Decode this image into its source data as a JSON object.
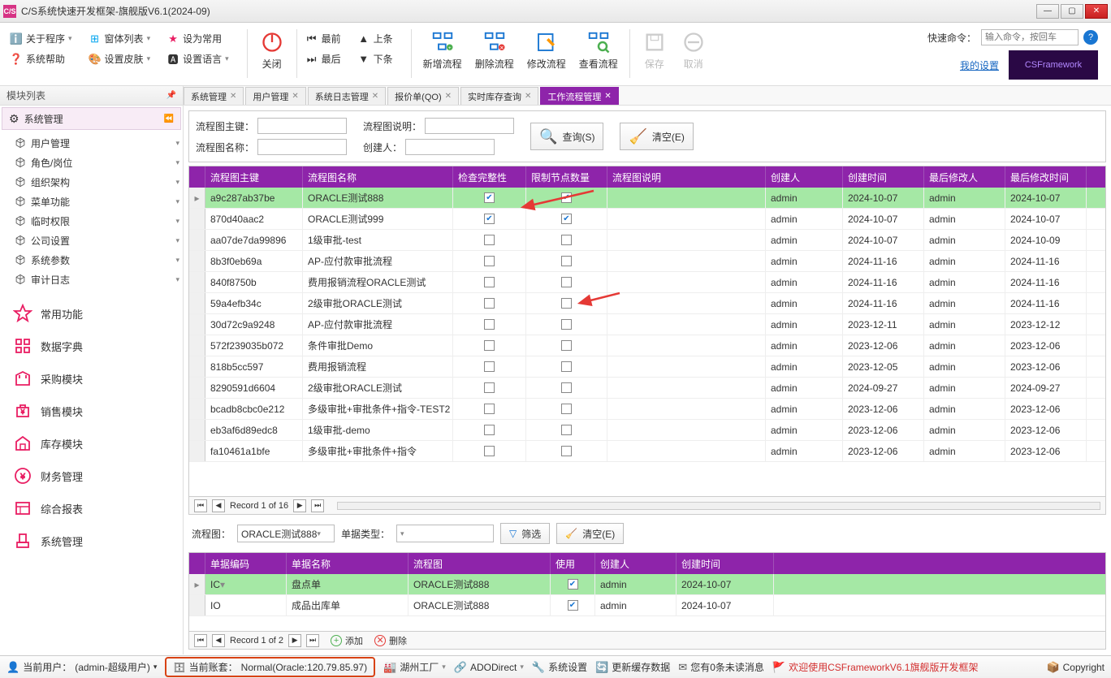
{
  "window": {
    "title": "C/S系统快速开发框架-旗舰版V6.1(2024-09)"
  },
  "menubar": {
    "about": "关于程序",
    "winlist": "窗体列表",
    "setcommon": "设为常用",
    "syshelp": "系统帮助",
    "setskin": "设置皮肤",
    "setlang": "设置语言"
  },
  "toolbar": {
    "close": "关闭",
    "first": "最前",
    "last": "最后",
    "prev": "上条",
    "next": "下条",
    "addflow": "新增流程",
    "delflow": "删除流程",
    "editflow": "修改流程",
    "viewflow": "查看流程",
    "save": "保存",
    "cancel": "取消",
    "quickcmd_label": "快速命令：",
    "quickcmd_placeholder": "输入命令，按回车",
    "mysettings": "我的设置",
    "brand": "CSFramework"
  },
  "sidebar": {
    "title": "模块列表",
    "active_cat": "系统管理",
    "tree": [
      {
        "label": "用户管理"
      },
      {
        "label": "角色/岗位"
      },
      {
        "label": "组织架构"
      },
      {
        "label": "菜单功能"
      },
      {
        "label": "临时权限"
      },
      {
        "label": "公司设置"
      },
      {
        "label": "系统参数"
      },
      {
        "label": "审计日志"
      }
    ],
    "quick": [
      {
        "label": "常用功能"
      },
      {
        "label": "数据字典"
      },
      {
        "label": "采购模块"
      },
      {
        "label": "销售模块"
      },
      {
        "label": "库存模块"
      },
      {
        "label": "财务管理"
      },
      {
        "label": "综合报表"
      },
      {
        "label": "系统管理"
      }
    ]
  },
  "tabs": [
    {
      "label": "系统管理"
    },
    {
      "label": "用户管理"
    },
    {
      "label": "系统日志管理"
    },
    {
      "label": "报价单(QO)"
    },
    {
      "label": "实时库存查询"
    },
    {
      "label": "工作流程管理",
      "active": true
    }
  ],
  "search": {
    "f1": "流程图主键：",
    "f2": "流程图说明：",
    "f3": "流程图名称：",
    "f4": "创建人：",
    "btn_query": "查询(S)",
    "btn_clear": "清空(E)"
  },
  "grid1": {
    "cols": [
      "流程图主键",
      "流程图名称",
      "检查完整性",
      "限制节点数量",
      "流程图说明",
      "创建人",
      "创建时间",
      "最后修改人",
      "最后修改时间"
    ],
    "rows": [
      {
        "id": "a9c287ab37be",
        "name": "ORACLE测试888",
        "chk": true,
        "lim": true,
        "desc": "",
        "creator": "admin",
        "ctime": "2024-10-07",
        "mod": "admin",
        "mtime": "2024-10-07",
        "hl": true,
        "sel": true
      },
      {
        "id": "870d40aac2",
        "name": "ORACLE测试999",
        "chk": true,
        "lim": true,
        "desc": "",
        "creator": "admin",
        "ctime": "2024-10-07",
        "mod": "admin",
        "mtime": "2024-10-07"
      },
      {
        "id": "aa07de7da99896",
        "name": "1级审批-test",
        "chk": false,
        "lim": false,
        "desc": "",
        "creator": "admin",
        "ctime": "2024-10-07",
        "mod": "admin",
        "mtime": "2024-10-09"
      },
      {
        "id": "8b3f0eb69a",
        "name": "AP-应付款审批流程",
        "chk": false,
        "lim": false,
        "desc": "",
        "creator": "admin",
        "ctime": "2024-11-16",
        "mod": "admin",
        "mtime": "2024-11-16"
      },
      {
        "id": "840f8750b",
        "name": "费用报销流程ORACLE测试",
        "chk": false,
        "lim": false,
        "desc": "",
        "creator": "admin",
        "ctime": "2024-11-16",
        "mod": "admin",
        "mtime": "2024-11-16"
      },
      {
        "id": "59a4efb34c",
        "name": "2级审批ORACLE测试",
        "chk": false,
        "lim": false,
        "desc": "",
        "creator": "admin",
        "ctime": "2024-11-16",
        "mod": "admin",
        "mtime": "2024-11-16"
      },
      {
        "id": "30d72c9a9248",
        "name": "AP-应付款审批流程",
        "chk": false,
        "lim": false,
        "desc": "",
        "creator": "admin",
        "ctime": "2023-12-11",
        "mod": "admin",
        "mtime": "2023-12-12"
      },
      {
        "id": "572f239035b072",
        "name": "条件审批Demo",
        "chk": false,
        "lim": false,
        "desc": "",
        "creator": "admin",
        "ctime": "2023-12-06",
        "mod": "admin",
        "mtime": "2023-12-06"
      },
      {
        "id": "818b5cc597",
        "name": "费用报销流程",
        "chk": false,
        "lim": false,
        "desc": "",
        "creator": "admin",
        "ctime": "2023-12-05",
        "mod": "admin",
        "mtime": "2023-12-06"
      },
      {
        "id": "8290591d6604",
        "name": "2级审批ORACLE测试",
        "chk": false,
        "lim": false,
        "desc": "",
        "creator": "admin",
        "ctime": "2024-09-27",
        "mod": "admin",
        "mtime": "2024-09-27"
      },
      {
        "id": "bcadb8cbc0e212",
        "name": "多级审批+审批条件+指令-TEST2",
        "chk": false,
        "lim": false,
        "desc": "",
        "creator": "admin",
        "ctime": "2023-12-06",
        "mod": "admin",
        "mtime": "2023-12-06"
      },
      {
        "id": "eb3af6d89edc8",
        "name": "1级审批-demo",
        "chk": false,
        "lim": false,
        "desc": "",
        "creator": "admin",
        "ctime": "2023-12-06",
        "mod": "admin",
        "mtime": "2023-12-06"
      },
      {
        "id": "fa10461a1bfe",
        "name": "多级审批+审批条件+指令",
        "chk": false,
        "lim": false,
        "desc": "",
        "creator": "admin",
        "ctime": "2023-12-06",
        "mod": "admin",
        "mtime": "2023-12-06"
      }
    ],
    "pager": "Record 1 of 16"
  },
  "filter2": {
    "flow_label": "流程图：",
    "flow_value": "ORACLE测试888",
    "doc_label": "单据类型：",
    "btn_filter": "筛选",
    "btn_clear": "清空(E)"
  },
  "grid2": {
    "cols": [
      "单据编码",
      "单据名称",
      "流程图",
      "使用",
      "创建人",
      "创建时间"
    ],
    "rows": [
      {
        "code": "IC",
        "name": "盘点单",
        "flow": "ORACLE测试888",
        "use": true,
        "creator": "admin",
        "ctime": "2024-10-07",
        "hl": true,
        "sel": true
      },
      {
        "code": "IO",
        "name": "成品出库单",
        "flow": "ORACLE测试888",
        "use": true,
        "creator": "admin",
        "ctime": "2024-10-07"
      }
    ],
    "pager": "Record 1 of 2",
    "btn_add": "添加",
    "btn_del": "删除"
  },
  "statusbar": {
    "user_label": "当前用户：",
    "user_value": "(admin-超级用户)",
    "acct_label": "当前账套：",
    "acct_value": "Normal(Oracle:120.79.85.97)",
    "factory": "湖州工厂",
    "ado": "ADODirect",
    "syssetting": "系统设置",
    "refresh": "更新缓存数据",
    "msgs": "您有0条未读消息",
    "welcome": "欢迎使用CSFrameworkV6.1旗舰版开发框架",
    "copyright": "Copyright"
  }
}
